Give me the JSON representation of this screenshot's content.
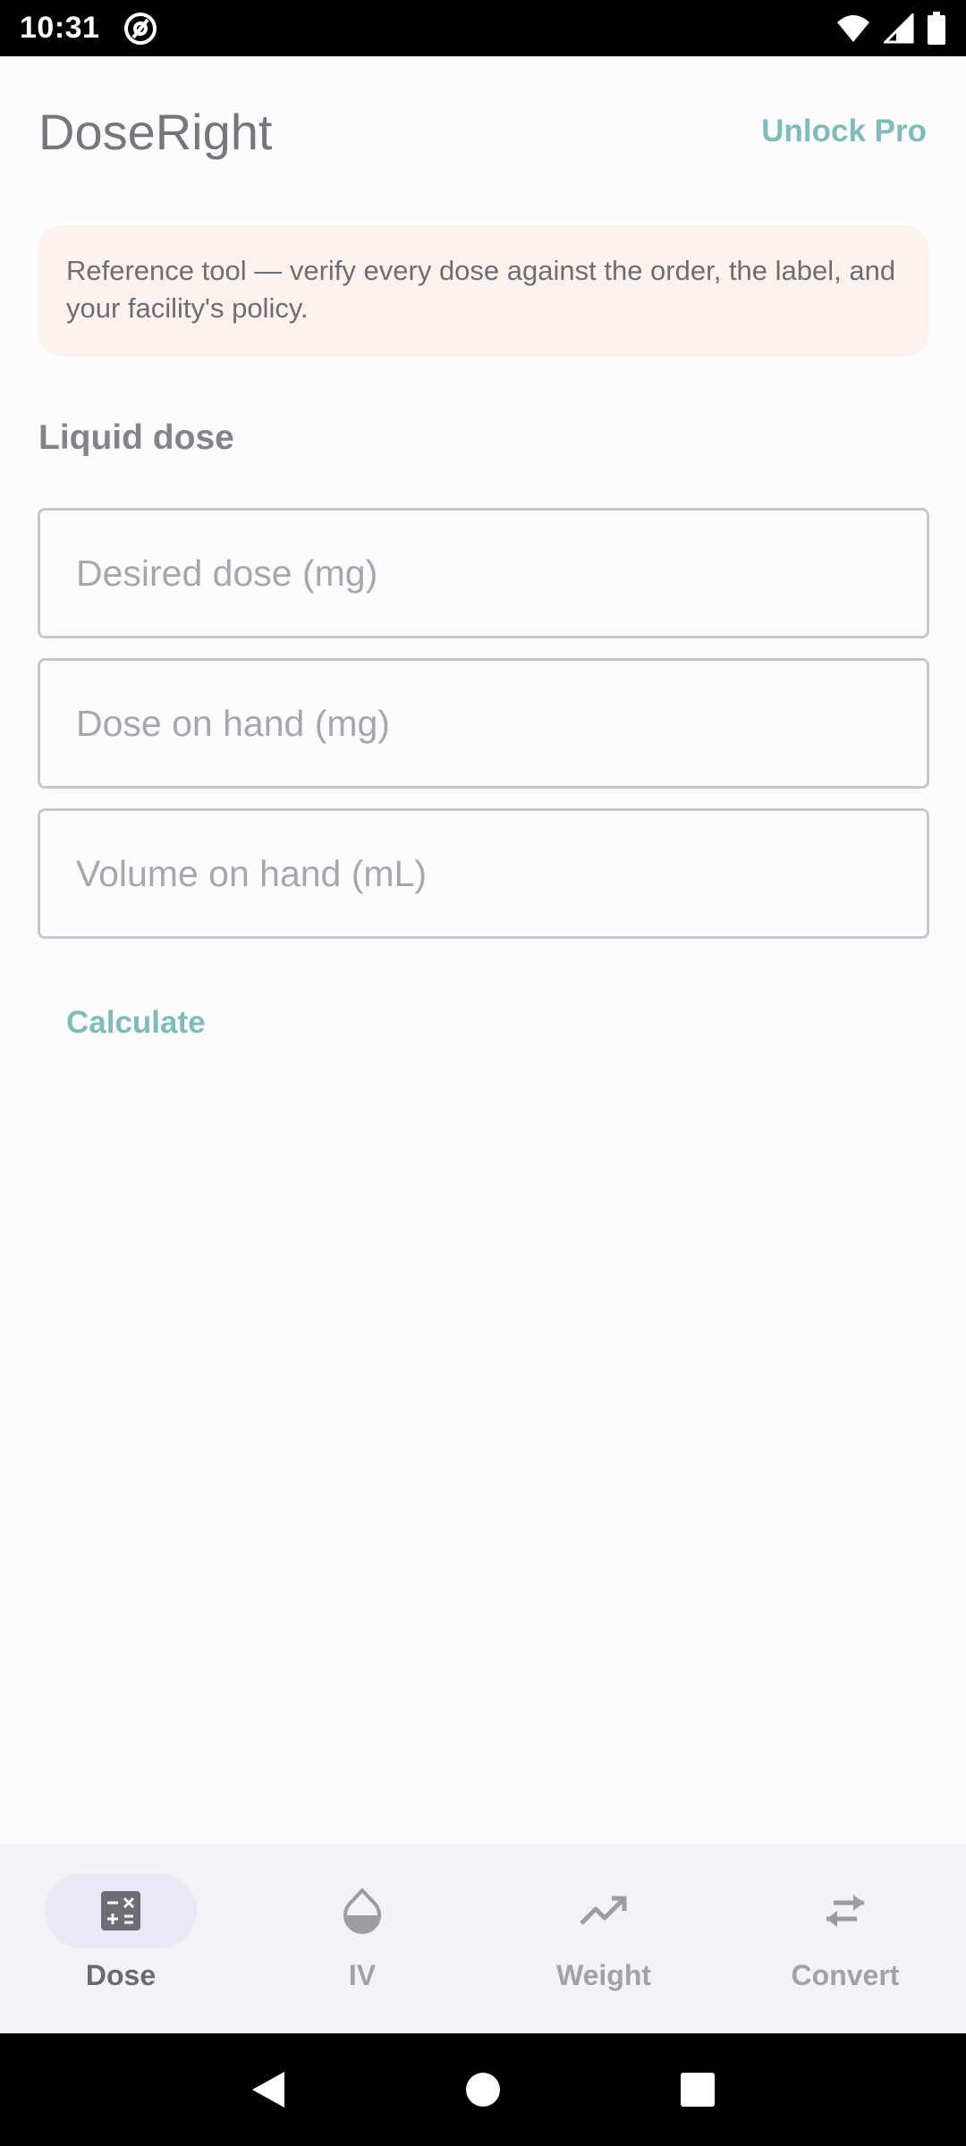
{
  "status_bar": {
    "time": "10:31",
    "icons": [
      "at-sign-icon",
      "wifi-icon",
      "signal-icon",
      "battery-icon"
    ]
  },
  "app": {
    "title": "DoseRight",
    "unlock_label": "Unlock Pro",
    "accent_color": "#7dbcbb"
  },
  "disclaimer": {
    "text": "Reference tool — verify every dose against the order, the label, and your facility's policy."
  },
  "form": {
    "section_label": "Liquid dose",
    "fields": [
      {
        "placeholder": "Desired dose (mg)",
        "value": ""
      },
      {
        "placeholder": "Dose on hand (mg)",
        "value": ""
      },
      {
        "placeholder": "Volume on hand (mL)",
        "value": ""
      }
    ],
    "calculate_label": "Calculate"
  },
  "bottom_nav": {
    "items": [
      {
        "label": "Dose",
        "icon": "calculator-icon",
        "active": true
      },
      {
        "label": "IV",
        "icon": "drop-icon",
        "active": false
      },
      {
        "label": "Weight",
        "icon": "trend-up-icon",
        "active": false
      },
      {
        "label": "Convert",
        "icon": "swap-arrows-icon",
        "active": false
      }
    ]
  },
  "system_nav": {
    "icons": [
      "back-icon",
      "home-icon",
      "recents-icon"
    ]
  }
}
